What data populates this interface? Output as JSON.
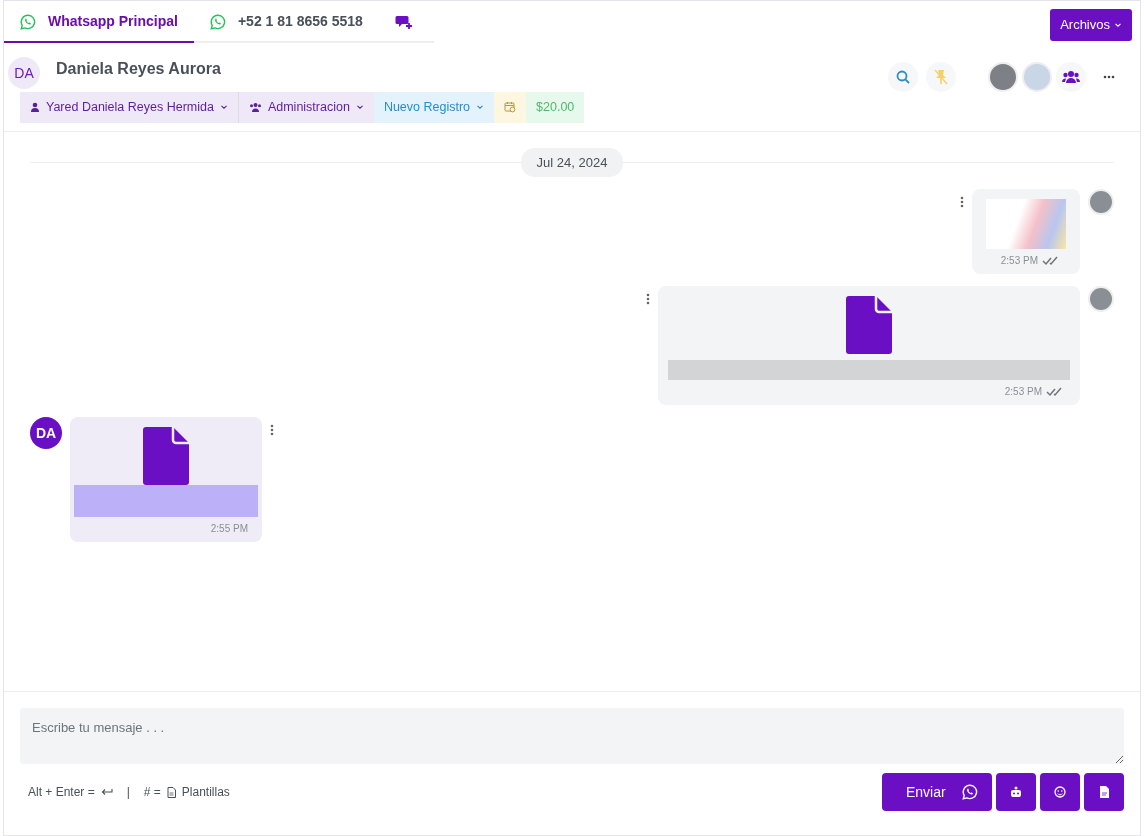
{
  "tabs": [
    {
      "kind": "whatsapp",
      "label": "Whatsapp Principal",
      "selected": true
    },
    {
      "kind": "whatsapp",
      "label": "+52 1 81 8656 5518",
      "selected": false
    },
    {
      "kind": "new-chat",
      "selected": false
    }
  ],
  "files_button": "Archivos",
  "contact": {
    "initials": "DA",
    "name": "Daniela Reyes Aurora"
  },
  "tags": [
    {
      "kind": "user",
      "label": "Yared Daniela Reyes Hermida"
    },
    {
      "kind": "team",
      "label": "Administracion"
    },
    {
      "kind": "stage",
      "label": "Nuevo Registro"
    },
    {
      "kind": "date"
    },
    {
      "kind": "amount",
      "label": "$20.00"
    }
  ],
  "date_divider": "Jul 24, 2024",
  "messages": [
    {
      "outgoing": true,
      "kind": "image",
      "time": "2:53 PM",
      "read": true
    },
    {
      "outgoing": true,
      "kind": "file",
      "time": "2:53 PM",
      "read": true
    },
    {
      "outgoing": false,
      "kind": "file",
      "time": "2:55 PM",
      "sender_initials": "DA"
    }
  ],
  "composer": {
    "placeholder": "Escribe tu mensaje . . .",
    "hint_send": "Alt + Enter =",
    "separator": "|",
    "hint_templates": "# =",
    "templates_label": "Plantillas",
    "send_label": "Enviar"
  }
}
